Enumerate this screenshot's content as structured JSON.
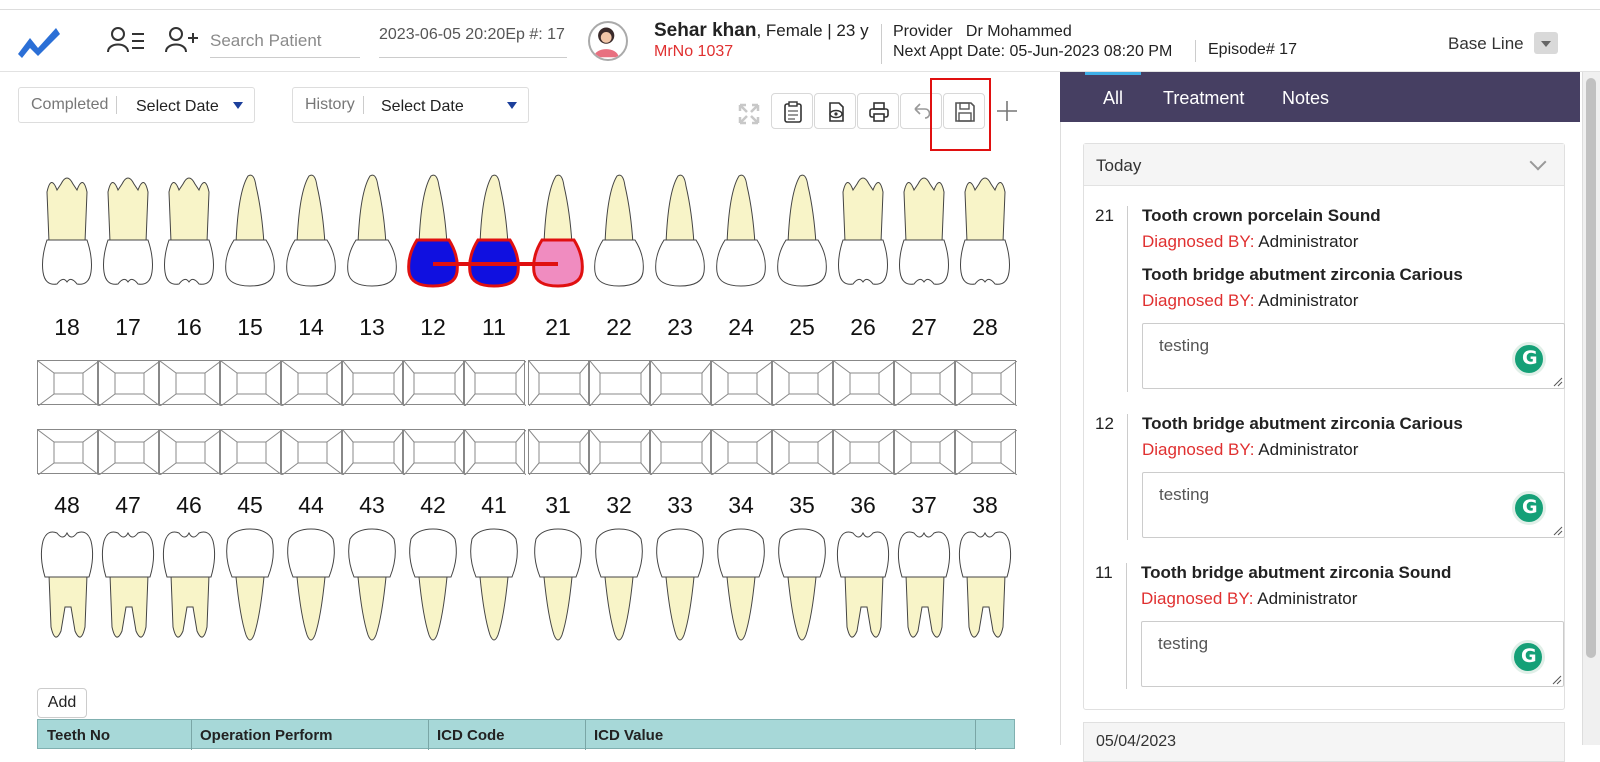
{
  "header": {
    "search_placeholder": "Search Patient",
    "episode_field": "2023-06-05 20:20Ep #: 17",
    "patient": {
      "name": "Sehar khan",
      "details": ", Female | 23 y",
      "mrno": "MrNo 1037"
    },
    "provider_label": "Provider",
    "provider_name": "Dr Mohammed",
    "next_appt": "Next Appt Date: 05-Jun-2023 08:20 PM",
    "episode": "Episode# 17",
    "baseline": "Base Line"
  },
  "filters": {
    "completed_label": "Completed",
    "completed_value": "Select Date",
    "history_label": "History",
    "history_value": "Select Date"
  },
  "toolbar": {
    "icons": [
      "expand-icon",
      "clipboard-icon",
      "preview-icon",
      "print-icon",
      "undo-icon",
      "save-icon",
      "add-icon"
    ]
  },
  "chart": {
    "upper_teeth": [
      "18",
      "17",
      "16",
      "15",
      "14",
      "13",
      "12",
      "11",
      "21",
      "22",
      "23",
      "24",
      "25",
      "26",
      "27",
      "28"
    ],
    "lower_teeth": [
      "48",
      "47",
      "46",
      "45",
      "44",
      "43",
      "42",
      "41",
      "31",
      "32",
      "33",
      "34",
      "35",
      "36",
      "37",
      "38"
    ],
    "marked": {
      "12": "#1010e0",
      "11": "#1010e0",
      "21": "#f08cc0"
    },
    "marker_outline": "#e01010",
    "crown_color": "#f8f4c8"
  },
  "table": {
    "add_label": "Add",
    "columns": [
      "Teeth No",
      "Operation Perform",
      "ICD Code",
      "ICD Value"
    ]
  },
  "right_panel": {
    "tabs": [
      "All",
      "Treatment",
      "Notes"
    ],
    "active_tab": "All",
    "group_title": "Today",
    "entries": [
      {
        "tooth": "21",
        "items": [
          {
            "title": "Tooth crown porcelain Sound",
            "diag_label": "Diagnosed BY:",
            "diag_by": "Administrator"
          },
          {
            "title": "Tooth bridge abutment zirconia Carious",
            "diag_label": "Diagnosed BY:",
            "diag_by": "Administrator"
          }
        ],
        "note": "testing"
      },
      {
        "tooth": "12",
        "items": [
          {
            "title": "Tooth bridge abutment zirconia Carious",
            "diag_label": "Diagnosed BY:",
            "diag_by": "Administrator"
          }
        ],
        "note": "testing"
      },
      {
        "tooth": "11",
        "items": [
          {
            "title": "Tooth bridge abutment zirconia Sound",
            "diag_label": "Diagnosed BY:",
            "diag_by": "Administrator"
          }
        ],
        "note": "testing"
      }
    ],
    "next_group_title": "05/04/2023"
  }
}
